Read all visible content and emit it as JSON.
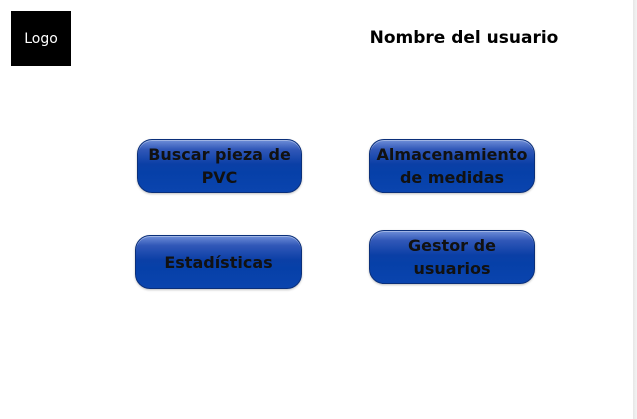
{
  "header": {
    "logo_text": "Logo",
    "user_name": "Nombre del usuario"
  },
  "menu": {
    "buscar_pieza": "Buscar pieza de PVC",
    "almacenamiento": "Almacenamiento de medidas",
    "estadisticas": "Estadísticas",
    "gestor_usuarios": "Gestor de usuarios"
  },
  "colors": {
    "button_blue": "#0640a8",
    "logo_background": "#000000",
    "page_background": "#ffffff"
  }
}
